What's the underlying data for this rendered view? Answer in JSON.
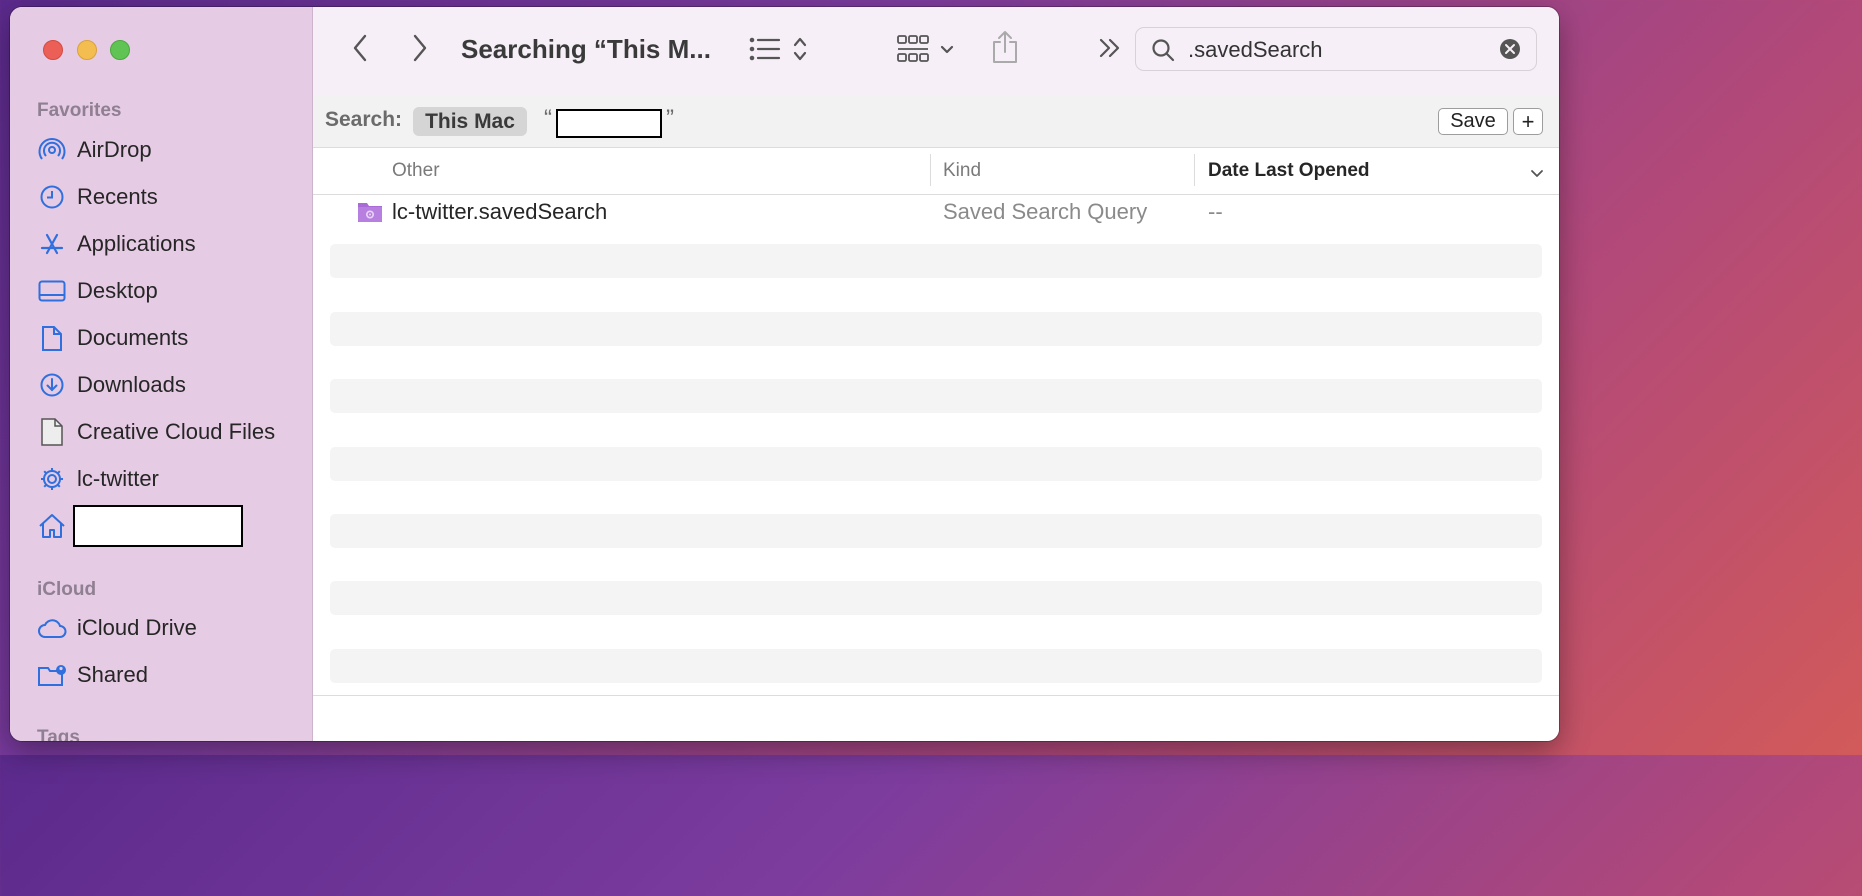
{
  "toolbar": {
    "title": "Searching “This M...",
    "search_value": ".savedSearch"
  },
  "sidebar": {
    "favorites_header": "Favorites",
    "items": [
      {
        "label": "AirDrop",
        "icon": "airdrop-icon"
      },
      {
        "label": "Recents",
        "icon": "clock-icon"
      },
      {
        "label": "Applications",
        "icon": "applications-icon"
      },
      {
        "label": "Desktop",
        "icon": "desktop-icon"
      },
      {
        "label": "Documents",
        "icon": "document-icon"
      },
      {
        "label": "Downloads",
        "icon": "download-icon"
      },
      {
        "label": "Creative Cloud Files",
        "icon": "file-icon"
      },
      {
        "label": "lc-twitter",
        "icon": "gear-icon"
      },
      {
        "label": "",
        "icon": "home-icon"
      }
    ],
    "icloud_header": "iCloud",
    "icloud_items": [
      {
        "label": "iCloud Drive",
        "icon": "cloud-icon"
      },
      {
        "label": "Shared",
        "icon": "shared-folder-icon"
      }
    ],
    "tags_header": "Tags"
  },
  "scope": {
    "label": "Search:",
    "this_mac": "This Mac",
    "open_quote": "“",
    "close_quote": "”",
    "save_label": "Save",
    "plus_label": "+"
  },
  "columns": {
    "name": "Other",
    "kind": "Kind",
    "date": "Date Last Opened"
  },
  "rows": [
    {
      "name": "lc-twitter.savedSearch",
      "kind": "Saved Search Query",
      "date": "--"
    }
  ],
  "colors": {
    "accent": "#2f6fde",
    "sidebar_bg": "#e6cbe4"
  }
}
